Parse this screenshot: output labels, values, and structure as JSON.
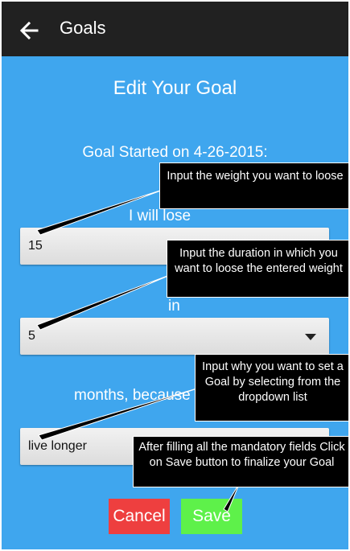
{
  "appbar": {
    "title": "Goals",
    "back_icon": "arrow-left-icon"
  },
  "heading": "Edit Your Goal",
  "started": "Goal Started on 4-26-2015:",
  "labels": {
    "lose": "I will lose",
    "in": "in",
    "because": "months, because"
  },
  "fields": {
    "weight": "15",
    "duration": "5",
    "reason": "live longer"
  },
  "buttons": {
    "cancel": "Cancel",
    "save": "Save"
  },
  "callouts": {
    "weight": "Input the weight you want to loose",
    "duration": "Input the duration in which you want to loose the entered weight",
    "reason": "Input why you want to set a Goal by selecting from the dropdown list",
    "save": "After filling all the mandatory fields Click on Save button to finalize your Goal"
  },
  "colors": {
    "background": "#3fa6ee",
    "appbar": "#212121",
    "cancel": "#ee3f3f",
    "save": "#5ef14a"
  }
}
